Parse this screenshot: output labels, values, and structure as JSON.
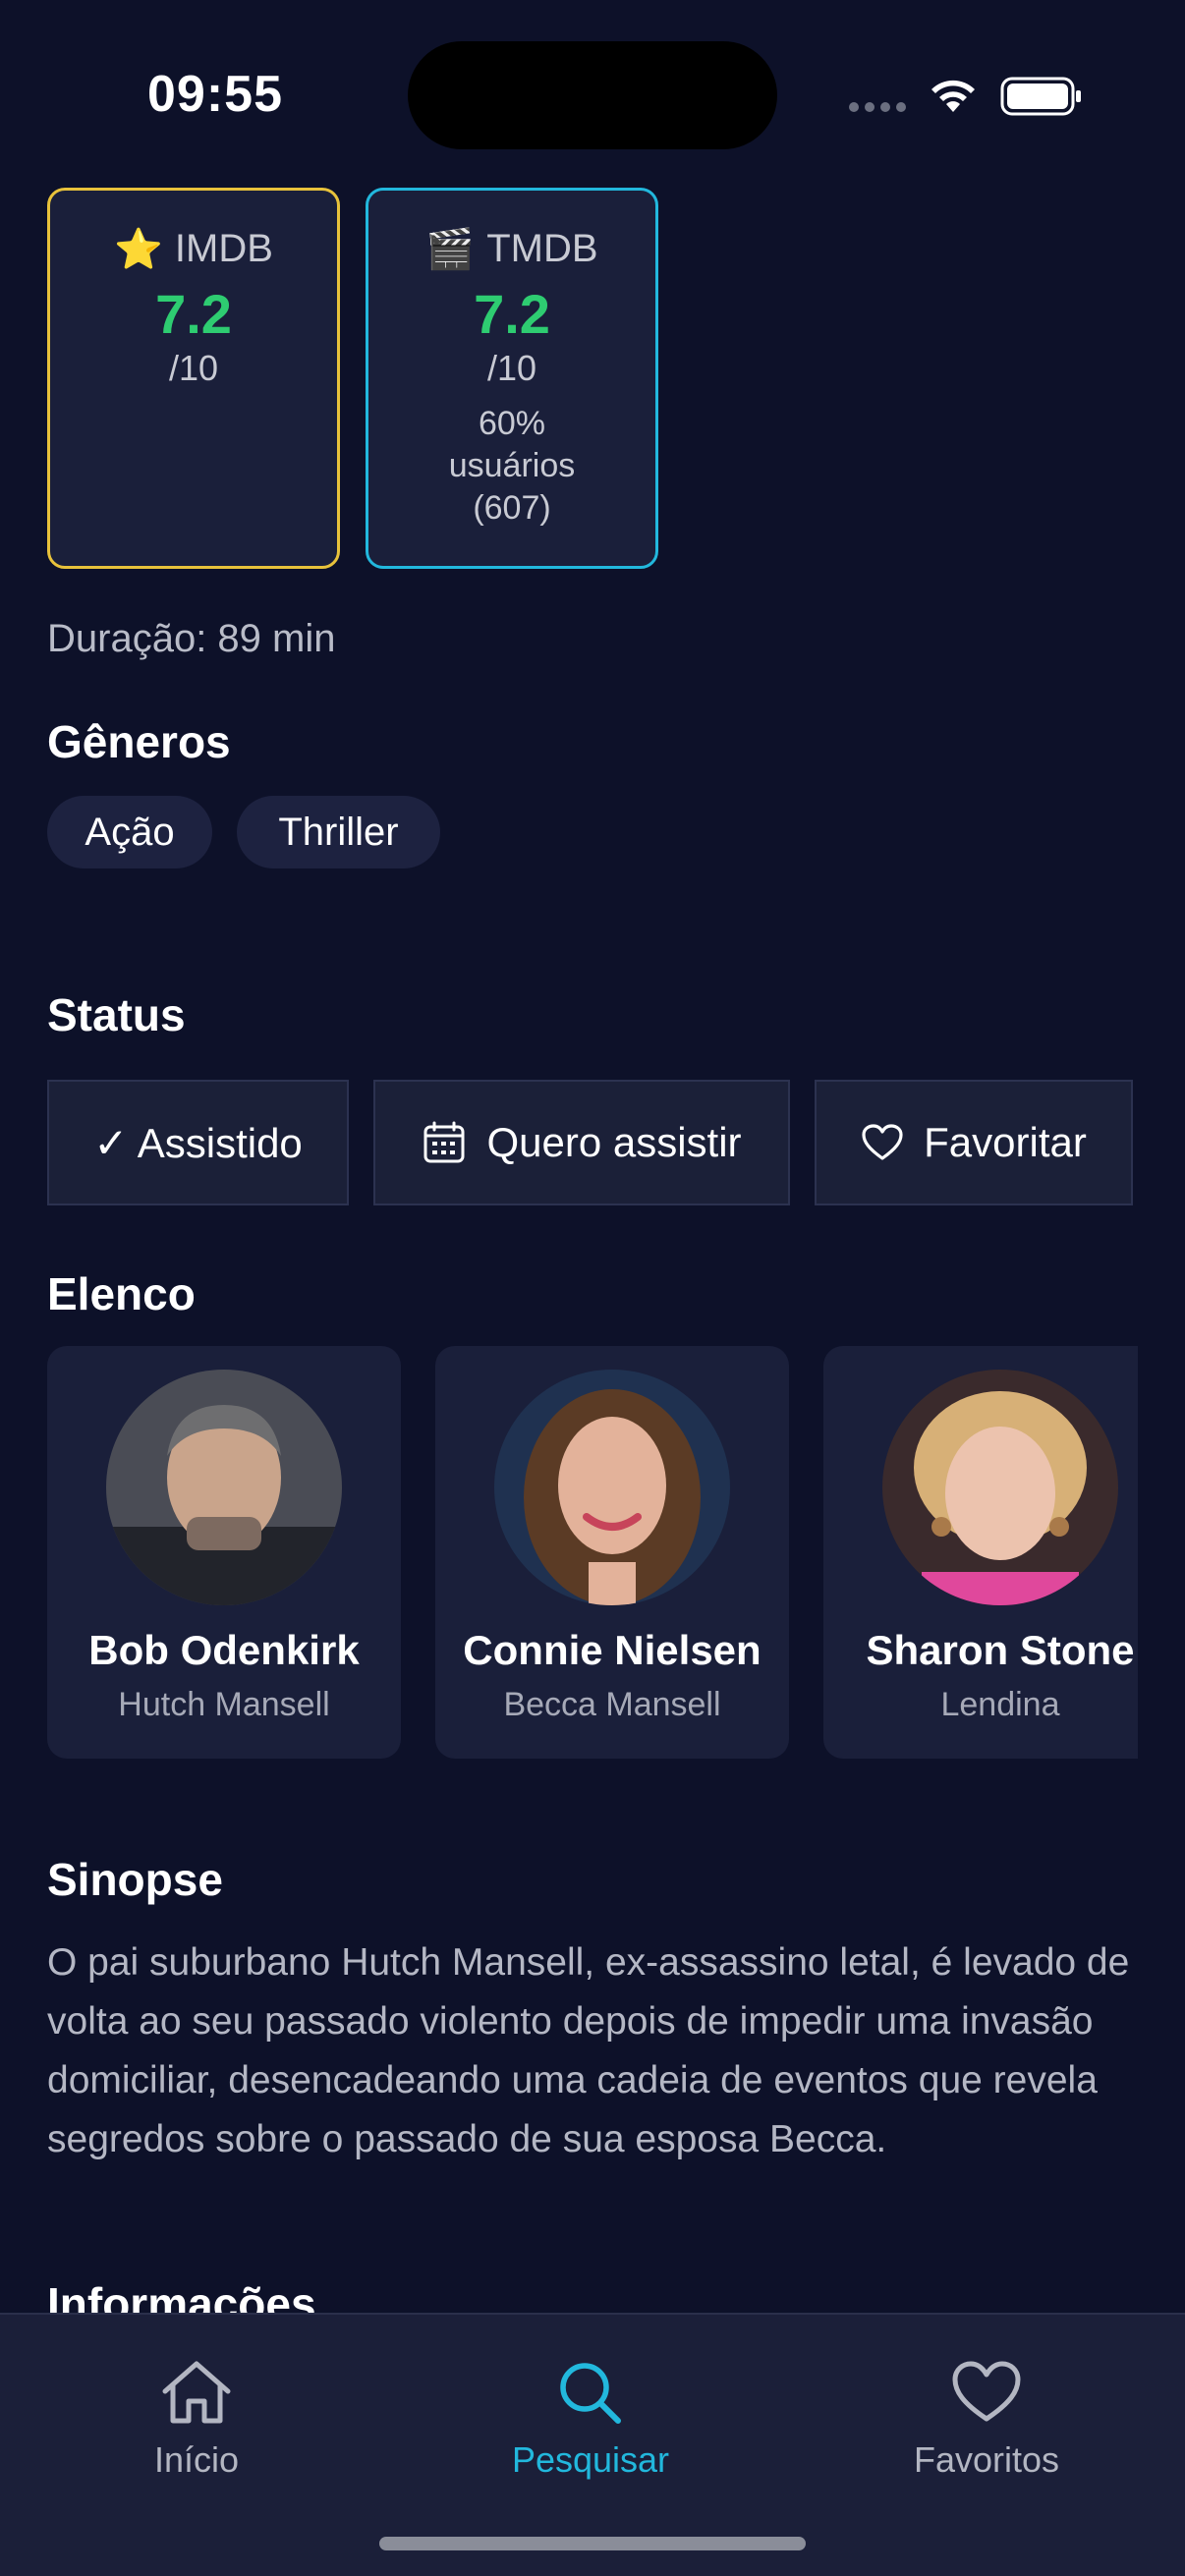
{
  "status_bar": {
    "time": "09:55"
  },
  "ratings": [
    {
      "icon": "⭐",
      "source": "IMDB",
      "score": "7.2",
      "max": "/10",
      "border": "#e8c23b"
    },
    {
      "icon": "🎬",
      "source": "TMDB",
      "score": "7.2",
      "max": "/10",
      "percent": "60%",
      "users_label": "usuários",
      "votes": "(607)",
      "border": "#22b8dd"
    }
  ],
  "duration": "Duração: 89 min",
  "genres": {
    "title": "Gêneros",
    "items": [
      "Ação",
      "Thriller"
    ]
  },
  "status": {
    "title": "Status",
    "watched": "✓ Assistido",
    "want": "Quero assistir",
    "favorite": "Favoritar"
  },
  "cast": {
    "title": "Elenco",
    "items": [
      {
        "name": "Bob Odenkirk",
        "role": "Hutch Mansell"
      },
      {
        "name": "Connie Nielsen",
        "role": "Becca Mansell"
      },
      {
        "name": "Sharon Stone",
        "role": "Lendina"
      }
    ]
  },
  "synopsis": {
    "title": "Sinopse",
    "text": "O pai suburbano Hutch Mansell, ex-assassino letal, é levado de volta ao seu passado violento depois de impedir uma invasão domiciliar, desencadeando uma cadeia de eventos que revela segredos sobre o passado de sua esposa Becca."
  },
  "info_title": "Informações",
  "tabs": [
    {
      "label": "Início",
      "icon": "home-icon",
      "active": false
    },
    {
      "label": "Pesquisar",
      "icon": "search-icon",
      "active": true
    },
    {
      "label": "Favoritos",
      "icon": "heart-icon",
      "active": false
    }
  ],
  "colors": {
    "background": "#0d1129",
    "accent": "#22b8dd",
    "score": "#2ecc71",
    "imdb": "#e8c23b"
  }
}
